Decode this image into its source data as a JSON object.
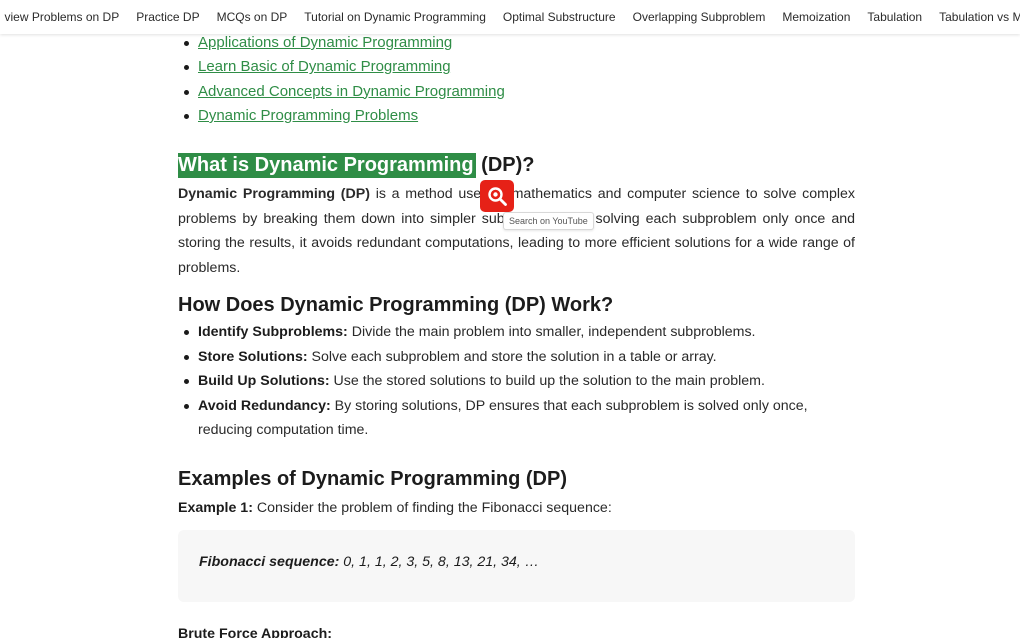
{
  "topnav": {
    "items": [
      "view Problems on DP",
      "Practice DP",
      "MCQs on DP",
      "Tutorial on Dynamic Programming",
      "Optimal Substructure",
      "Overlapping Subproblem",
      "Memoization",
      "Tabulation",
      "Tabulation vs Memoi"
    ]
  },
  "toc": {
    "links": [
      "Applications of Dynamic Programming",
      "Learn Basic of Dynamic Programming",
      "Advanced Concepts in Dynamic Programming",
      "Dynamic Programming Problems"
    ]
  },
  "section_what": {
    "heading_highlight": "What is Dynamic Programming",
    "heading_rest": " (DP)?",
    "para_bold": "Dynamic Programming (DP)",
    "para_text": " is a method used in mathematics and computer science to solve complex problems by breaking them down into simpler subproblems. By solving each subproblem only once and storing the results, it avoids redundant computations, leading to more efficient solutions for a wide range of problems."
  },
  "section_how": {
    "heading": "How Does Dynamic Programming (DP) Work?",
    "steps": [
      {
        "title": "Identify Subproblems:",
        "text": " Divide the main problem into smaller, independent subproblems."
      },
      {
        "title": "Store Solutions:",
        "text": " Solve each subproblem and store the solution in a table or array."
      },
      {
        "title": "Build Up Solutions:",
        "text": " Use the stored solutions to build up the solution to the main problem."
      },
      {
        "title": "Avoid Redundancy:",
        "text": " By storing solutions, DP ensures that each subproblem is solved only once, reducing computation time."
      }
    ]
  },
  "section_examples": {
    "heading": "Examples of Dynamic Programming (DP)",
    "example_label": "Example 1:",
    "example_text": " Consider the problem of finding the Fibonacci sequence:",
    "code_label": "Fibonacci sequence:",
    "code_text": " 0, 1, 1, 2, 3, 5, 8, 13, 21, 34, …",
    "brute_force": "Brute Force Approach:"
  },
  "youtube_popup": {
    "icon": "search-magnifier-icon",
    "tooltip": "Search on YouTube",
    "color": "#e62117"
  },
  "colors": {
    "accent": "#2f8d46",
    "link": "#2f8d46"
  }
}
